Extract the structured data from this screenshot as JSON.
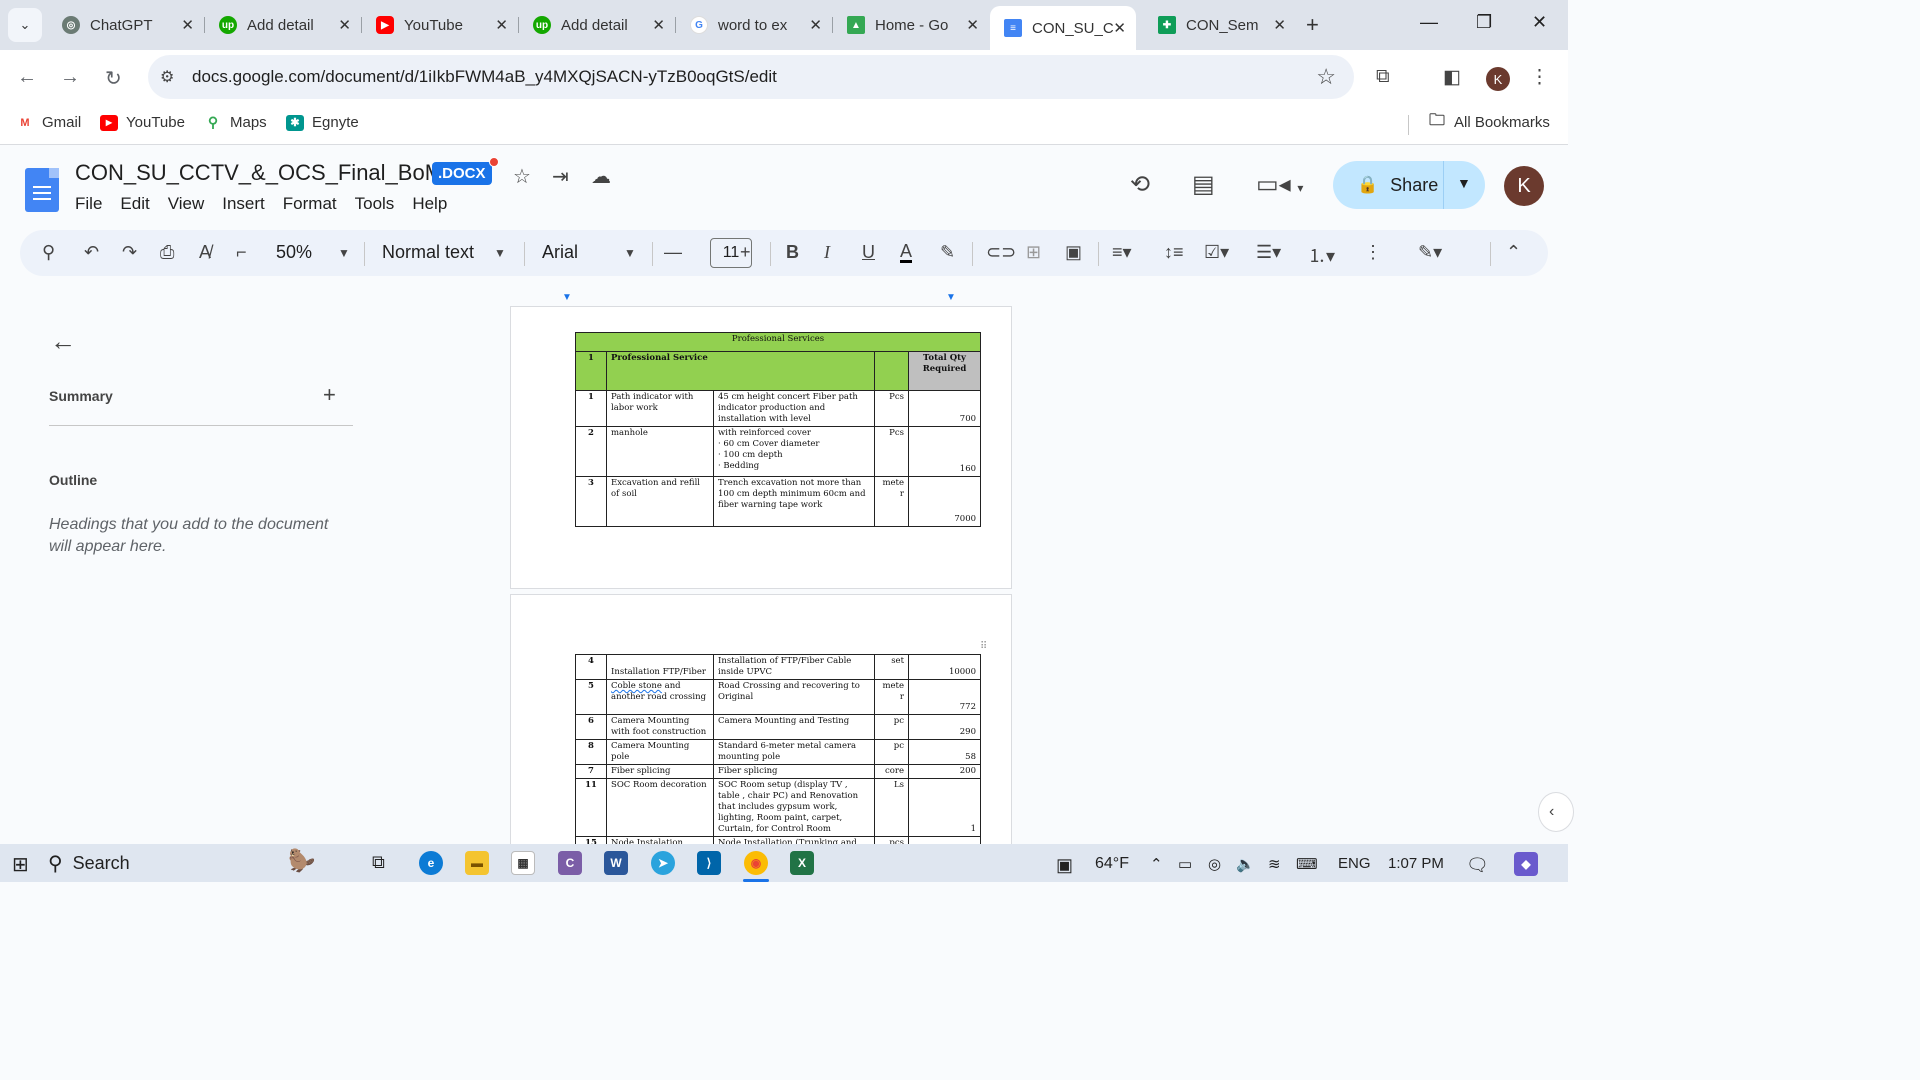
{
  "browser": {
    "tabs": [
      {
        "title": "ChatGPT",
        "icon": "chatgpt-icon",
        "color": "#6b7b74"
      },
      {
        "title": "Add detail",
        "icon": "upwork-icon",
        "color": "#14a800"
      },
      {
        "title": "YouTube",
        "icon": "youtube-icon",
        "color": "#ff0000"
      },
      {
        "title": "Add detail",
        "icon": "upwork-icon",
        "color": "#14a800"
      },
      {
        "title": "word to ex",
        "icon": "google-icon",
        "color": "#4285f4"
      },
      {
        "title": "Home - Go",
        "icon": "drive-icon",
        "color": "#34a853"
      },
      {
        "title": "CON_SU_C",
        "icon": "docs-icon",
        "color": "#4285f4"
      },
      {
        "title": "CON_Sem",
        "icon": "sheets-icon",
        "color": "#0f9d58"
      }
    ],
    "url": "docs.google.com/document/d/1iIkbFWM4aB_y4MXQjSACN-yTzB0oqGtS/edit",
    "profile_initial": "K",
    "bookmarks": [
      {
        "label": "Gmail",
        "icon": "gmail-icon"
      },
      {
        "label": "YouTube",
        "icon": "youtube-icon"
      },
      {
        "label": "Maps",
        "icon": "maps-icon"
      },
      {
        "label": "Egnyte",
        "icon": "egnyte-icon"
      }
    ],
    "all_bookmarks": "All Bookmarks"
  },
  "docs": {
    "title": "CON_SU_CCTV_&_OCS_Final_BoM",
    "badge": ".DOCX",
    "menu": [
      "File",
      "Edit",
      "View",
      "Insert",
      "Format",
      "Tools",
      "Help"
    ],
    "share_label": "Share",
    "avatar_initial": "K",
    "toolbar": {
      "zoom": "50%",
      "style": "Normal text",
      "font": "Arial",
      "font_size": "11"
    },
    "outline": {
      "summary": "Summary",
      "outline_heading": "Outline",
      "hint": "Headings that you add to the document will appear here."
    }
  },
  "table1": {
    "title": "Professional Services",
    "head_no": "1",
    "head_service": "Professional Service",
    "head_qty": "Total Qty Required",
    "rows": [
      {
        "no": "1",
        "item": "Path indicator  with labor work",
        "desc": "45 cm height concert Fiber path indicator production and installation with level",
        "unit": "Pcs",
        "qty": "700"
      },
      {
        "no": "2",
        "item": "manhole",
        "desc": "with reinforced cover\n· 60 cm Cover diameter\n· 100 cm depth\n· Bedding",
        "unit": "Pcs",
        "qty": "160"
      },
      {
        "no": "3",
        "item": "Excavation and refill of soil",
        "desc": "Trench excavation not more than 100 cm depth minimum 60cm and fiber warning tape work",
        "unit": "mete\nr",
        "qty": "7000"
      }
    ]
  },
  "table2": {
    "rows": [
      {
        "no": "4",
        "item": "\nInstallation FTP/Fiber",
        "desc": "Installation of FTP/Fiber Cable inside UPVC",
        "unit": "set",
        "qty": "10000"
      },
      {
        "no": "5",
        "item_a": "Coble stone",
        "item_b": " and another road crossing",
        "desc": "Road Crossing and recovering to Original",
        "unit": "mete\nr",
        "qty": "772"
      },
      {
        "no": "6",
        "item": "Camera Mounting with foot construction",
        "desc": "Camera Mounting and Testing",
        "unit": "pc",
        "qty": "290"
      },
      {
        "no": "8",
        "item": "Camera Mounting pole",
        "desc": "Standard 6-meter metal camera mounting pole",
        "unit": "pc",
        "qty": "58"
      },
      {
        "no": "7",
        "item": "Fiber splicing",
        "desc": "Fiber splicing",
        "unit": "core",
        "qty": "200"
      },
      {
        "no": "11",
        "item": "SOC Room decoration",
        "desc": "SOC Room setup (display TV , table , chair PC) and Renovation that includes gypsum work, lighting, Room paint, carpet, Curtain, for Control Room",
        "unit": "Ls",
        "qty": "1"
      },
      {
        "no": "15",
        "item": "Node Instalation",
        "desc": "Node Installation (Trunking and",
        "unit": "pcs",
        "qty": ""
      }
    ]
  },
  "taskbar": {
    "search_label": "Search",
    "weather": "64°F",
    "lang": "ENG",
    "time": "1:07 PM"
  }
}
